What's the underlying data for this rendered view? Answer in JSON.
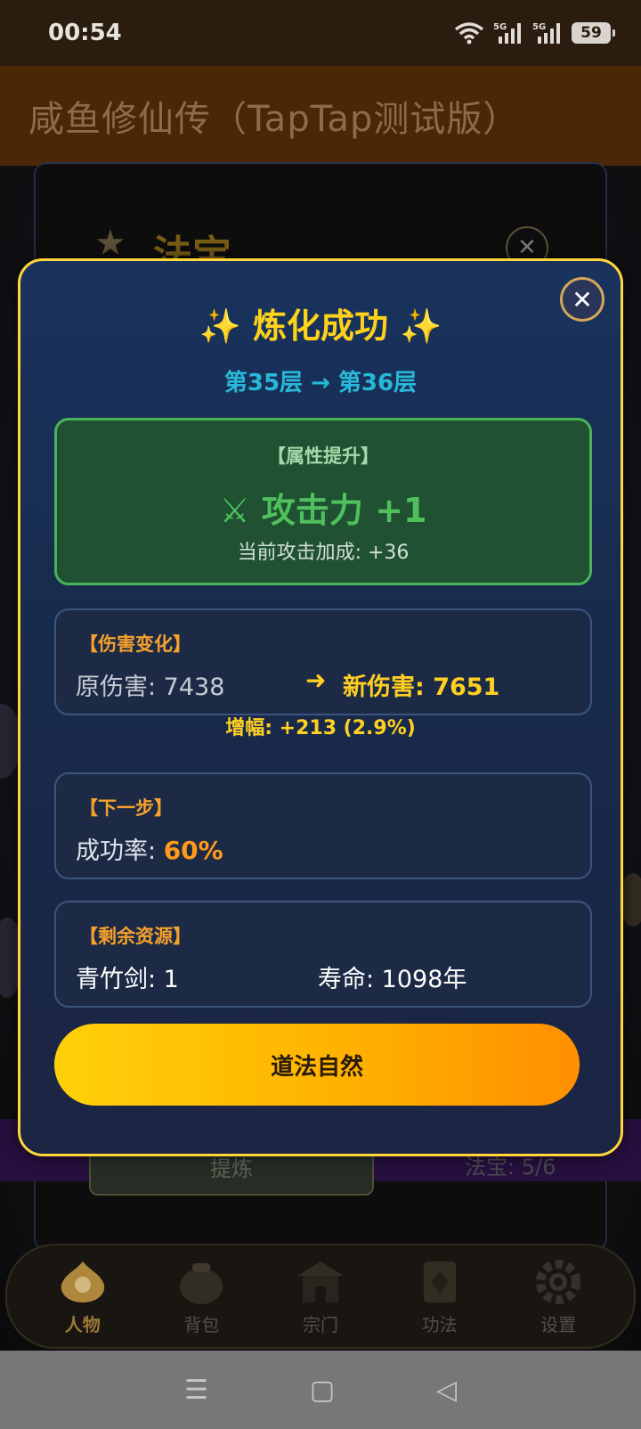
{
  "status_bar": {
    "time": "00:54",
    "signal_1": "5G",
    "signal_2": "5G",
    "battery": "59",
    "icons": [
      "wifi-icon",
      "signal-5g-icon",
      "signal-5g-icon",
      "battery-icon"
    ]
  },
  "header": {
    "title": "咸鱼修仙传（TapTap测试版）"
  },
  "background": {
    "panel_star": "★",
    "panel_title": "法宝",
    "panel_close": "✕",
    "button_label": "提炼",
    "footer_label": "法宝: 5/6"
  },
  "modal": {
    "close": "✕",
    "title": "✨ 炼化成功 ✨",
    "subtitle": "第35层 → 第36层",
    "attribute": {
      "header": "【属性提升】",
      "main": "⚔ 攻击力 +1",
      "sub": "当前攻击加成: +36"
    },
    "damage": {
      "header": "【伤害变化】",
      "original": "原伤害: 7438",
      "arrow": "➜",
      "new": "新伤害: 7651",
      "increase": "增幅: +213 (2.9%)"
    },
    "next": {
      "header": "【下一步】",
      "rate_label": "成功率: ",
      "rate_value": "60%"
    },
    "resources": {
      "header": "【剩余资源】",
      "sword": "青竹剑: 1",
      "lifespan": "寿命: 1098年"
    },
    "confirm": "道法自然"
  },
  "bottom_nav": {
    "items": [
      {
        "label": "人物",
        "icon": "character-icon",
        "active": true
      },
      {
        "label": "背包",
        "icon": "bag-icon",
        "active": false
      },
      {
        "label": "宗门",
        "icon": "sect-icon",
        "active": false
      },
      {
        "label": "功法",
        "icon": "technique-icon",
        "active": false
      },
      {
        "label": "设置",
        "icon": "gear-icon",
        "active": false
      }
    ]
  },
  "android_nav": {
    "menu": "☰",
    "home": "▢",
    "back": "◁"
  },
  "colors": {
    "modal_border": "#ffd53a",
    "title_gold": "#ffd21a",
    "subtitle_cyan": "#28b8d8",
    "attribute_green": "#4fc05c",
    "section_orange": "#f6a12c",
    "rate_orange": "#ff9a1a",
    "app_header": "#4a2705"
  }
}
